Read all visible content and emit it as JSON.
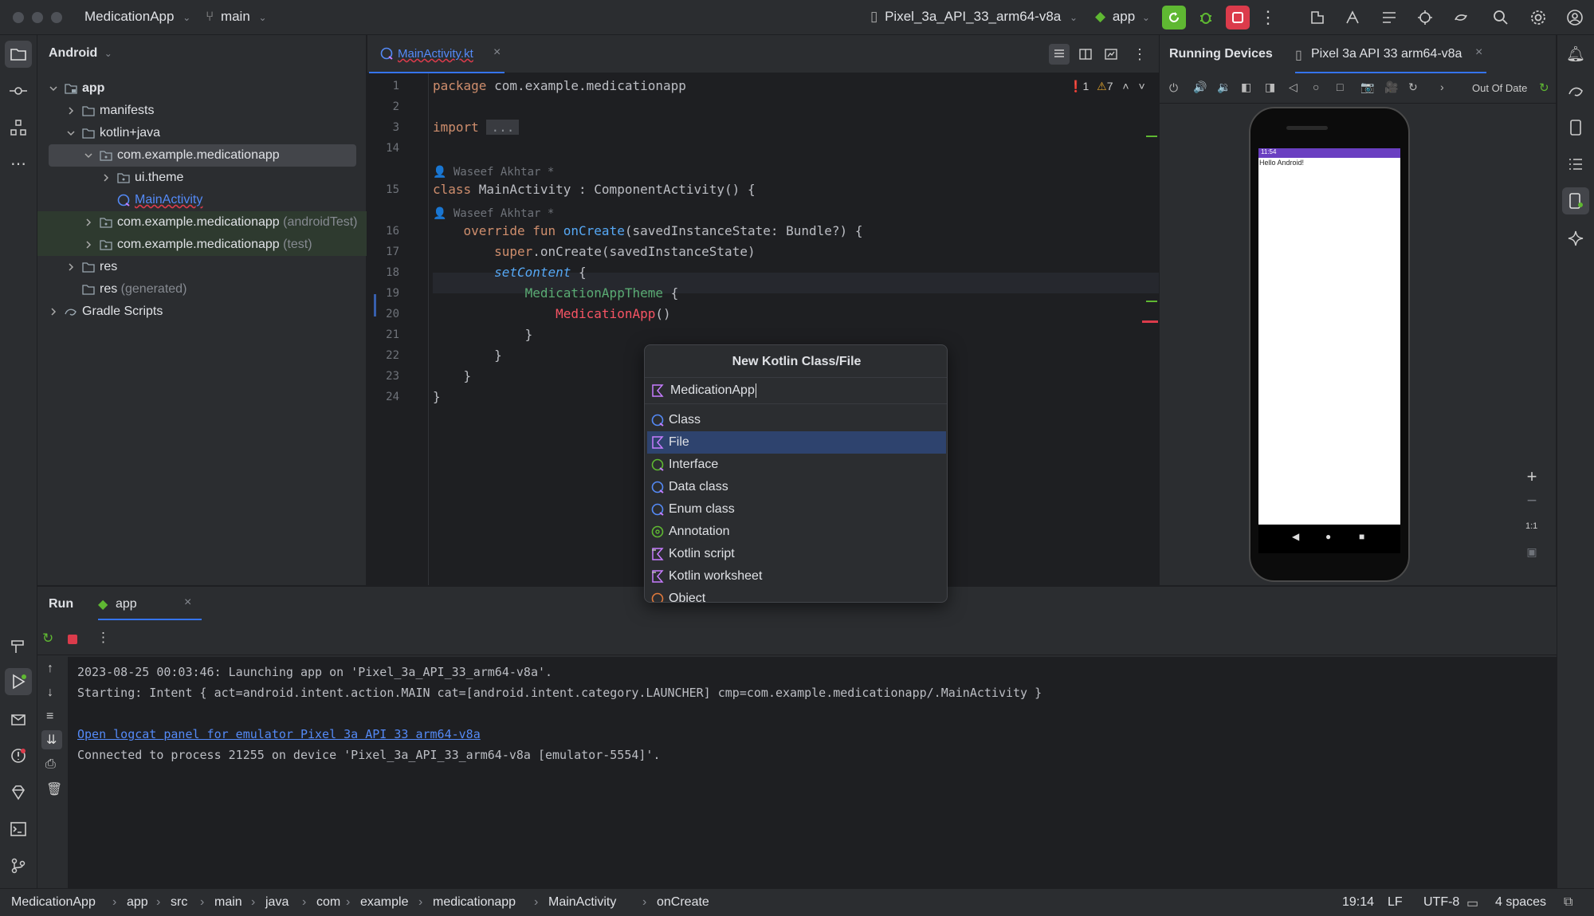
{
  "titlebar": {
    "project": "MedicationApp",
    "branch": "main",
    "device": "Pixel_3a_API_33_arm64-v8a",
    "run_config": "app",
    "icons": [
      "rerun-icon",
      "debug-icon",
      "stop-icon",
      "more-icon",
      "build-icon",
      "translate-icon",
      "tasks-icon",
      "plugin-icon",
      "sync-icon",
      "search-icon",
      "settings-icon",
      "account-icon"
    ]
  },
  "project_panel": {
    "view": "Android",
    "tree": [
      {
        "label": "app",
        "bold": true,
        "icon": "module-folder-icon",
        "depth": 0,
        "expanded": true
      },
      {
        "label": "manifests",
        "icon": "folder-icon",
        "depth": 1,
        "expanded": false
      },
      {
        "label": "kotlin+java",
        "icon": "folder-icon",
        "depth": 1,
        "expanded": true
      },
      {
        "label": "com.example.medicationapp",
        "icon": "package-icon",
        "depth": 2,
        "expanded": true,
        "selected": true
      },
      {
        "label": "ui.theme",
        "icon": "package-icon",
        "depth": 3,
        "expanded": false
      },
      {
        "label": "MainActivity",
        "icon": "kotlin-class-icon",
        "depth": 3,
        "leaf": true
      },
      {
        "label": "com.example.medicationapp",
        "suffix": "(androidTest)",
        "icon": "package-icon",
        "depth": 2,
        "expanded": false,
        "green": true
      },
      {
        "label": "com.example.medicationapp",
        "suffix": "(test)",
        "icon": "package-icon",
        "depth": 2,
        "expanded": false,
        "green": true
      },
      {
        "label": "res",
        "icon": "folder-icon",
        "depth": 1,
        "expanded": false
      },
      {
        "label": "res",
        "suffix": "(generated)",
        "icon": "folder-icon",
        "depth": 1,
        "leaf": true
      },
      {
        "label": "Gradle Scripts",
        "icon": "gradle-icon",
        "depth": 0,
        "expanded": false
      }
    ]
  },
  "editor": {
    "tab": "MainActivity.kt",
    "inspections": {
      "errors": "1",
      "warnings": "7"
    },
    "lines": [
      {
        "num": "1",
        "parts": [
          [
            "kw",
            "package "
          ],
          [
            "",
            "com.example.medicationapp"
          ]
        ]
      },
      {
        "num": "2",
        "parts": []
      },
      {
        "num": "3",
        "parts": [
          [
            "kw",
            "import "
          ],
          [
            "fold",
            "..."
          ]
        ]
      },
      {
        "num": "14",
        "parts": []
      },
      {
        "author": "Waseef Akhtar *"
      },
      {
        "num": "15",
        "parts": [
          [
            "kw",
            "class "
          ],
          [
            "",
            "MainActivity : ComponentActivity() {"
          ]
        ]
      },
      {
        "author": "Waseef Akhtar *"
      },
      {
        "num": "16",
        "parts": [
          [
            "",
            "    "
          ],
          [
            "kw",
            "override fun "
          ],
          [
            "fn",
            "onCreate"
          ],
          [
            "",
            "(savedInstanceState: Bundle?) {"
          ]
        ]
      },
      {
        "num": "17",
        "parts": [
          [
            "",
            "        "
          ],
          [
            "kw",
            "super"
          ],
          [
            "",
            ".onCreate(savedInstanceState)"
          ]
        ]
      },
      {
        "num": "18",
        "parts": [
          [
            "",
            "        "
          ],
          [
            "it",
            "setContent"
          ],
          [
            "",
            " {"
          ]
        ]
      },
      {
        "num": "19",
        "parts": [
          [
            "",
            "            "
          ],
          [
            "comp",
            "MedicationAppTheme"
          ],
          [
            "",
            " {"
          ]
        ]
      },
      {
        "num": "20",
        "parts": [
          [
            "",
            "                "
          ],
          [
            "red",
            "MedicationApp"
          ],
          [
            "",
            "()"
          ]
        ]
      },
      {
        "num": "21",
        "parts": [
          [
            "",
            "            }"
          ]
        ]
      },
      {
        "num": "22",
        "parts": [
          [
            "",
            "        }"
          ]
        ]
      },
      {
        "num": "23",
        "parts": [
          [
            "",
            "    }"
          ]
        ]
      },
      {
        "num": "24",
        "parts": [
          [
            "",
            "}"
          ]
        ]
      }
    ]
  },
  "devices": {
    "title": "Running Devices",
    "tab": "Pixel 3a API 33 arm64-v8a",
    "status": "Out Of Date",
    "screen_time": "11:54",
    "screen_text": "Hello Android!",
    "zoom_label": "1:1"
  },
  "dialog": {
    "title": "New Kotlin Class/File",
    "input_value": "MedicationApp",
    "items": [
      {
        "label": "Class",
        "icon": "class-icon"
      },
      {
        "label": "File",
        "icon": "kotlin-file-icon",
        "selected": true
      },
      {
        "label": "Interface",
        "icon": "interface-icon"
      },
      {
        "label": "Data class",
        "icon": "class-icon"
      },
      {
        "label": "Enum class",
        "icon": "class-icon"
      },
      {
        "label": "Annotation",
        "icon": "annotation-icon"
      },
      {
        "label": "Kotlin script",
        "icon": "script-icon"
      },
      {
        "label": "Kotlin worksheet",
        "icon": "script-icon"
      },
      {
        "label": "Object",
        "icon": "object-icon"
      }
    ]
  },
  "run": {
    "title": "Run",
    "tab": "app",
    "console": [
      {
        "text": "2023-08-25 00:03:46: Launching app on 'Pixel_3a_API_33_arm64-v8a'."
      },
      {
        "text": "Starting: Intent { act=android.intent.action.MAIN cat=[android.intent.category.LAUNCHER] cmp=com.example.medicationapp/.MainActivity }"
      },
      {
        "text": ""
      },
      {
        "text": "Open logcat panel for emulator Pixel 3a API 33 arm64-v8a",
        "link": true
      },
      {
        "text": "Connected to process 21255 on device 'Pixel_3a_API_33_arm64-v8a [emulator-5554]'."
      }
    ]
  },
  "statusbar": {
    "breadcrumbs": [
      "MedicationApp",
      "app",
      "src",
      "main",
      "java",
      "com",
      "example",
      "medicationapp",
      "MainActivity",
      "onCreate"
    ],
    "position": "19:14",
    "line_sep": "LF",
    "encoding": "UTF-8",
    "indent": "4 spaces"
  },
  "colors": {
    "accent": "#3574f0",
    "selection": "#2e436e",
    "run_green": "#5fb832",
    "stop_red": "#db3b4b"
  }
}
